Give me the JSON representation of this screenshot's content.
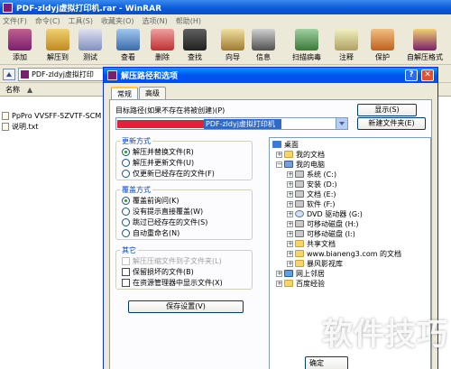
{
  "main_window": {
    "title": "PDF-zldyj虚拟打印机.rar - WinRAR",
    "menu": [
      "文件(F)",
      "命令(C)",
      "工具(S)",
      "收藏夹(O)",
      "选项(N)",
      "帮助(H)"
    ],
    "toolbar": [
      "添加",
      "解压到",
      "测试",
      "查看",
      "删除",
      "查找",
      "向导",
      "信息",
      "扫描病毒",
      "注释",
      "保护",
      "自解压格式"
    ],
    "address": "PDF-zldyj虚拟打印",
    "column_name": "名称",
    "files": [
      "PpPro  VVSFF-5ZVTF-SCM",
      "说明.txt"
    ]
  },
  "dialog": {
    "title": "解压路径和选项",
    "tabs": [
      "常规",
      "高级"
    ],
    "dest_label": "目标路径(如果不存在将被创建)(P)",
    "dest_value": "PDF-zldyj虚拟打印机",
    "show_button": "显示(S)",
    "new_folder_button": "新建文件夹(E)",
    "update_group": {
      "title": "更新方式",
      "options": [
        "解压并替换文件(R)",
        "解压并更新文件(U)",
        "仅更新已经存在的文件(F)"
      ],
      "selected": 0
    },
    "overwrite_group": {
      "title": "覆盖方式",
      "options": [
        "覆盖前询问(K)",
        "没有提示直接覆盖(W)",
        "跳过已经存在的文件(S)",
        "自动重命名(N)"
      ],
      "selected": 0
    },
    "misc_group": {
      "title": "其它",
      "options": [
        "解压压缩文件到子文件夹(L)",
        "保留损坏的文件(B)",
        "在资源管理器中显示文件(X)"
      ],
      "disabled": [
        true,
        false,
        false
      ]
    },
    "save_button": "保存设置(V)",
    "ok_button": "确定",
    "tree": [
      {
        "label": "桌面",
        "icon": "desktop-icon"
      },
      {
        "label": "我的文档",
        "icon": "documents-icon"
      },
      {
        "label": "我的电脑",
        "icon": "computer-icon"
      },
      {
        "label": "系统 (C:)",
        "icon": "drive-icon"
      },
      {
        "label": "安装 (D:)",
        "icon": "drive-icon"
      },
      {
        "label": "文档 (E:)",
        "icon": "drive-icon"
      },
      {
        "label": "软件 (F:)",
        "icon": "drive-icon"
      },
      {
        "label": "DVD 驱动器 (G:)",
        "icon": "cd-icon"
      },
      {
        "label": "可移动磁盘 (H:)",
        "icon": "removable-icon"
      },
      {
        "label": "可移动磁盘 (I:)",
        "icon": "removable-icon"
      },
      {
        "label": "共享文档",
        "icon": "folder-icon"
      },
      {
        "label": "www.bianeng3.com 的文档",
        "icon": "folder-icon"
      },
      {
        "label": "暴风影视库",
        "icon": "folder-icon"
      },
      {
        "label": "网上邻居",
        "icon": "network-icon"
      },
      {
        "label": "百度经验",
        "icon": "folder-icon"
      }
    ]
  },
  "watermark": "软件技巧"
}
